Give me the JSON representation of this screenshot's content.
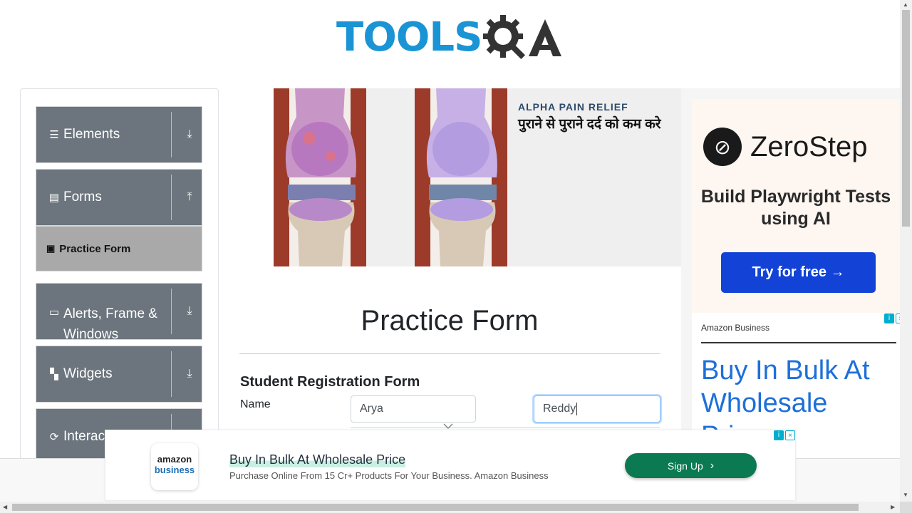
{
  "header": {
    "logo_tools": "TOOLS",
    "logo_qa": "QA"
  },
  "sidebar": {
    "groups": [
      {
        "label": "Elements",
        "icon": "menu-icon",
        "arrow": "download-arrow-icon"
      },
      {
        "label": "Forms",
        "icon": "document-icon",
        "arrow": "upload-arrow-icon"
      },
      {
        "label": "Alerts, Frame & Windows",
        "icon": "window-icon",
        "arrow": "download-arrow-icon"
      },
      {
        "label": "Widgets",
        "icon": "widgets-icon",
        "arrow": "download-arrow-icon"
      },
      {
        "label": "Interactions",
        "icon": "interaction-icon",
        "arrow": "download-arrow-icon"
      }
    ],
    "forms_items": [
      {
        "label": "Practice Form",
        "icon": "form-icon",
        "active": true
      }
    ]
  },
  "banner_ad": {
    "brand": "ALPHA PAIN RELIEF",
    "tagline": "पुराने से पुराने दर्द को कम करे"
  },
  "form": {
    "title": "Practice Form",
    "subtitle": "Student Registration Form",
    "name_label": "Name",
    "first_name_value": "Arya",
    "last_name_value": "Reddy"
  },
  "right_ad": {
    "zerostep_name": "ZeroStep",
    "zerostep_headline": "Build Playwright Tests using AI",
    "zerostep_button": "Try for free →",
    "amazon_label": "Amazon Business",
    "amazon_headline": "Buy In Bulk At Wholesale Price"
  },
  "bottom_ad": {
    "logo_line1": "amazon",
    "logo_line2": "business",
    "headline": "Buy In Bulk At Wholesale Price",
    "subtext": "Purchase Online From 15 Cr+ Products For Your Business. Amazon Business",
    "button": "Sign Up"
  },
  "colors": {
    "brand_blue": "#1a94d4",
    "sidebar_group": "#6c757d",
    "sidebar_active": "#a9a9a9",
    "zerostep_button": "#1242d6",
    "signup_button": "#0b7a52",
    "amazon_blue": "#1e6fd9"
  }
}
